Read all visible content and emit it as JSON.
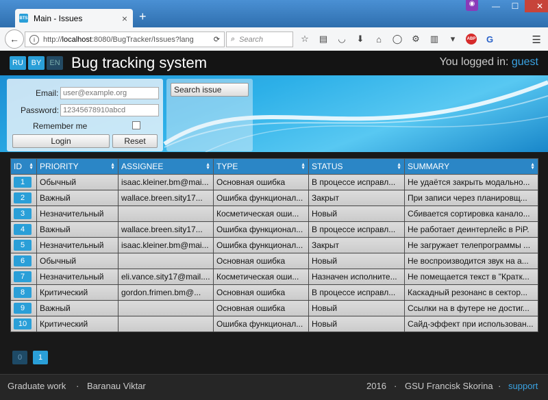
{
  "browser": {
    "tab_title": "Main - Issues",
    "favicon_text": "BTS",
    "url_host": "localhost",
    "url_rest": ":8080/BugTracker/Issues?lang",
    "url_prefix": "http://",
    "search_placeholder": "Search",
    "mask_icon": "mask-icon"
  },
  "header": {
    "langs": [
      "RU",
      "BY",
      "EN"
    ],
    "brand": "Bug tracking system",
    "logged_text": "You logged in: ",
    "logged_user": "guest"
  },
  "login": {
    "email_label": "Email:",
    "email_placeholder": "user@example.org",
    "password_label": "Password:",
    "password_placeholder": "12345678910abcd",
    "remember_label": "Remember me",
    "login_button": "Login",
    "reset_button": "Reset",
    "search_button": "Search issue"
  },
  "table": {
    "headers": [
      "ID",
      "PRIORITY",
      "ASSIGNEE",
      "TYPE",
      "STATUS",
      "SUMMARY"
    ],
    "rows": [
      {
        "id": "1",
        "priority": "Обычный",
        "assignee": "isaac.kleiner.bm@mai...",
        "type": "Основная ошибка",
        "status": "В процессе исправл...",
        "summary": "Не удаётся закрыть модально..."
      },
      {
        "id": "2",
        "priority": "Важный",
        "assignee": "wallace.breen.sity17...",
        "type": "Ошибка функционал...",
        "status": "Закрыт",
        "summary": "При записи через планировщ..."
      },
      {
        "id": "3",
        "priority": "Незначительный",
        "assignee": "",
        "type": "Косметическая оши...",
        "status": "Новый",
        "summary": "Сбивается сортировка канало..."
      },
      {
        "id": "4",
        "priority": "Важный",
        "assignee": "wallace.breen.sity17...",
        "type": "Ошибка функционал...",
        "status": "В процессе исправл...",
        "summary": "Не работает деинтерлейс в PiP."
      },
      {
        "id": "5",
        "priority": "Незначительный",
        "assignee": "isaac.kleiner.bm@mai...",
        "type": "Ошибка функционал...",
        "status": "Закрыт",
        "summary": "Не загружает телепрограммы ..."
      },
      {
        "id": "6",
        "priority": "Обычный",
        "assignee": "",
        "type": "Основная ошибка",
        "status": "Новый",
        "summary": "Не воспроизводится звук на а..."
      },
      {
        "id": "7",
        "priority": "Незначительный",
        "assignee": "eli.vance.sity17@mail....",
        "type": "Косметическая оши...",
        "status": "Назначен исполните...",
        "summary": "Не помещается текст в \"Кратк..."
      },
      {
        "id": "8",
        "priority": "Критический",
        "assignee": "gordon.frimen.bm@...",
        "type": "Основная ошибка",
        "status": "В процессе исправл...",
        "summary": "Каскадный резонанс в сектор..."
      },
      {
        "id": "9",
        "priority": "Важный",
        "assignee": "",
        "type": "Основная ошибка",
        "status": "Новый",
        "summary": "Ссылки на в футере не достиг..."
      },
      {
        "id": "10",
        "priority": "Критический",
        "assignee": "",
        "type": "Ошибка функционал...",
        "status": "Новый",
        "summary": "Сайд-эффект при использован..."
      }
    ]
  },
  "pager": {
    "prev": "0",
    "current": "1"
  },
  "footer": {
    "left1": "Graduate work",
    "sep": "·",
    "left2": "Baranau Viktar",
    "year": "2016",
    "org": "GSU Francisk Skorina",
    "support": "support"
  },
  "colors": {
    "accent": "#2a9fd8",
    "header_bg": "#2b86c6",
    "link": "#3aa3e3"
  }
}
